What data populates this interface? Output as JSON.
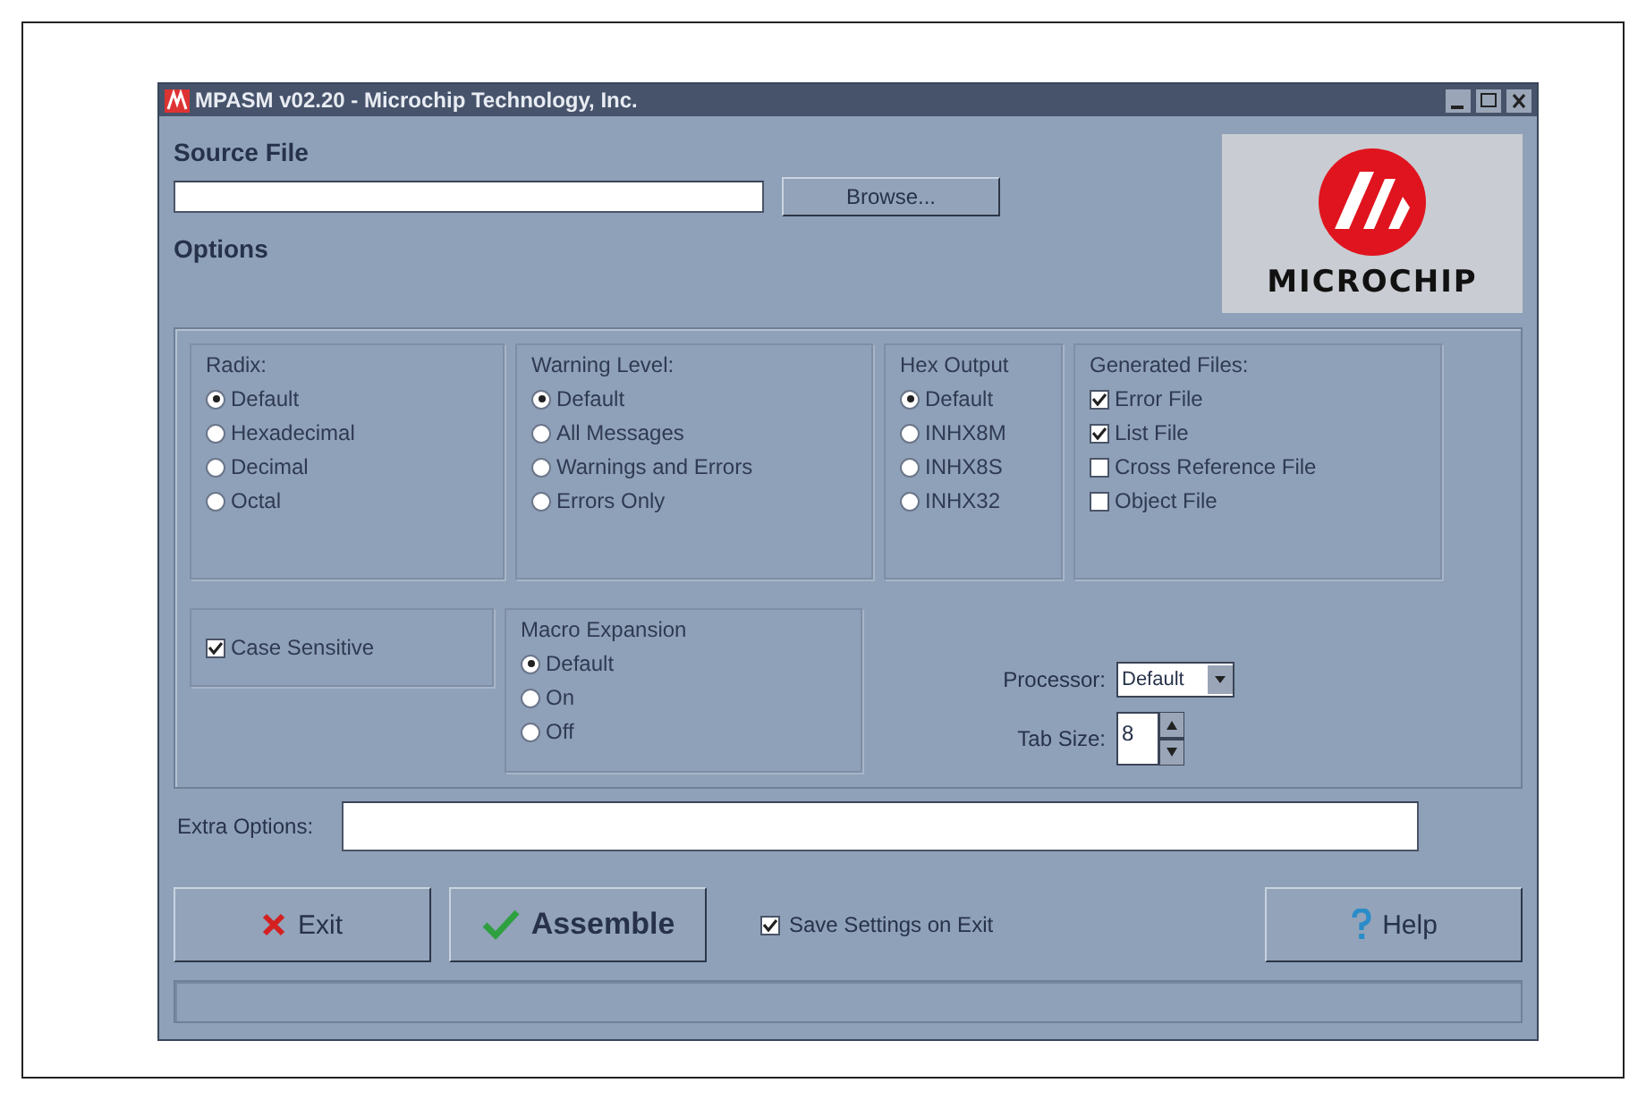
{
  "window": {
    "title": "MPASM v02.20 - Microchip Technology, Inc."
  },
  "source_file": {
    "label": "Source File",
    "browse": "Browse..."
  },
  "logo": {
    "text": "MICROCHIP"
  },
  "options_label": "Options",
  "groups": [
    {
      "title": "Radix:",
      "kind": "radio",
      "items": [
        {
          "label": "Default",
          "selected": true
        },
        {
          "label": "Hexadecimal",
          "selected": false
        },
        {
          "label": "Decimal",
          "selected": false
        },
        {
          "label": "Octal",
          "selected": false
        }
      ]
    },
    {
      "title": "Warning Level:",
      "kind": "radio",
      "items": [
        {
          "label": "Default",
          "selected": true
        },
        {
          "label": "All Messages",
          "selected": false
        },
        {
          "label": "Warnings and Errors",
          "selected": false
        },
        {
          "label": "Errors Only",
          "selected": false
        }
      ]
    },
    {
      "title": "Hex Output",
      "kind": "radio",
      "items": [
        {
          "label": "Default",
          "selected": true
        },
        {
          "label": "INHX8M",
          "selected": false
        },
        {
          "label": "INHX8S",
          "selected": false
        },
        {
          "label": "INHX32",
          "selected": false
        }
      ]
    },
    {
      "title": "Generated Files:",
      "kind": "check",
      "items": [
        {
          "label": "Error File",
          "checked": true
        },
        {
          "label": "List File",
          "checked": true
        },
        {
          "label": "Cross Reference File",
          "checked": false
        },
        {
          "label": "Object File",
          "checked": false
        }
      ]
    }
  ],
  "case_sensitive": {
    "label": "Case Sensitive",
    "checked": true
  },
  "macro_expansion": {
    "title": "Macro Expansion",
    "items": [
      {
        "label": "Default",
        "selected": true
      },
      {
        "label": "On",
        "selected": false
      },
      {
        "label": "Off",
        "selected": false
      }
    ]
  },
  "processor": {
    "label": "Processor:",
    "value": "Default"
  },
  "tab_size": {
    "label": "Tab Size:",
    "value": "8"
  },
  "extra_options": {
    "label": "Extra Options:"
  },
  "buttons": [
    {
      "kind": "exit",
      "label": "Exit"
    },
    {
      "kind": "assemble",
      "label": "Assemble"
    },
    {
      "kind": "help",
      "label": "Help"
    }
  ],
  "save_settings": {
    "label": "Save Settings on Exit",
    "checked": true
  }
}
